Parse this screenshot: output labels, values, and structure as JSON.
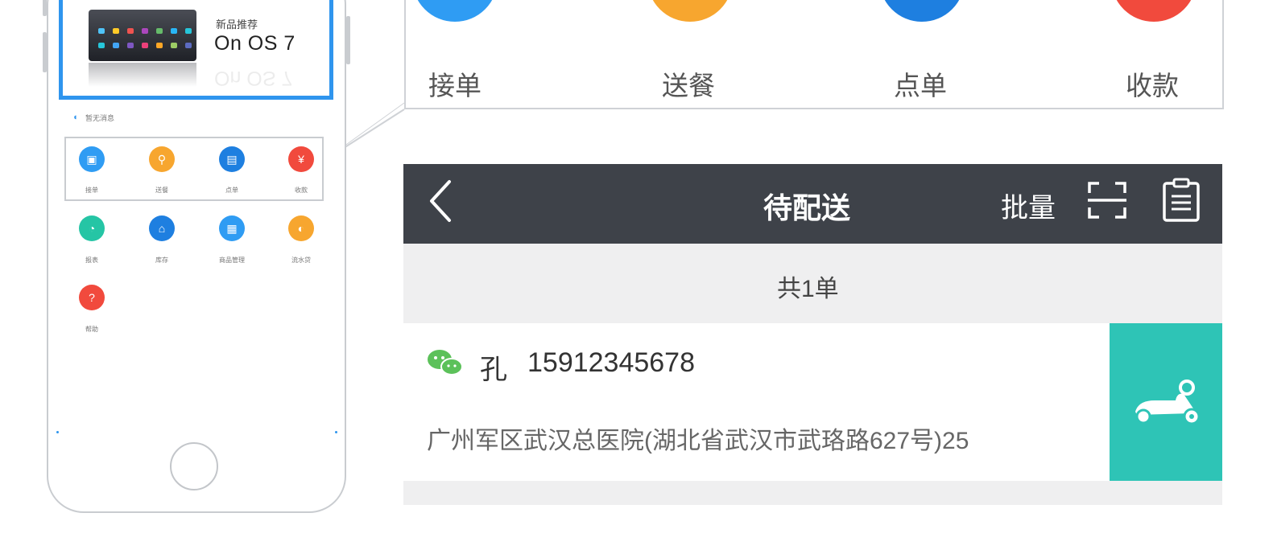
{
  "banner": {
    "subtitle": "新品推荐",
    "title": "On OS 7"
  },
  "notice": {
    "text": "暂无消息"
  },
  "mini_grid": [
    {
      "label": "接单",
      "color": "#2f9cf3",
      "icon": "order-icon",
      "glyph": "▣"
    },
    {
      "label": "送餐",
      "color": "#f7a62f",
      "icon": "scooter-icon",
      "glyph": "⚲"
    },
    {
      "label": "点单",
      "color": "#1e7fe0",
      "icon": "menu-icon",
      "glyph": "▤"
    },
    {
      "label": "收款",
      "color": "#f14a3d",
      "icon": "payment-icon",
      "glyph": "¥"
    },
    {
      "label": "报表",
      "color": "#25c5a5",
      "icon": "report-icon",
      "glyph": "◔"
    },
    {
      "label": "库存",
      "color": "#1e7fe0",
      "icon": "stock-icon",
      "glyph": "⌂"
    },
    {
      "label": "商品管理",
      "color": "#2f9cf3",
      "icon": "goods-icon",
      "glyph": "▦"
    },
    {
      "label": "流水贷",
      "color": "#f7a62f",
      "icon": "loan-icon",
      "glyph": "◐"
    },
    {
      "label": "帮助",
      "color": "#f14a3d",
      "icon": "help-icon",
      "glyph": "?"
    }
  ],
  "actions": [
    {
      "label": "接单",
      "color": "#2f9cf3"
    },
    {
      "label": "送餐",
      "color": "#f7a62f"
    },
    {
      "label": "点单",
      "color": "#1e7fe0"
    },
    {
      "label": "收款",
      "color": "#f14a3d"
    }
  ],
  "navbar": {
    "title": "待配送",
    "batch_label": "批量"
  },
  "summary": {
    "text": "共1单"
  },
  "order": {
    "name": "孔",
    "phone": "15912345678",
    "address": "广州军区武汉总医院(湖北省武汉市武珞路627号)25"
  },
  "colors": {
    "accent": "#2f95ee",
    "navbar": "#3e4249",
    "deliver": "#2ec4b6",
    "wechat": "#5cc15a"
  }
}
